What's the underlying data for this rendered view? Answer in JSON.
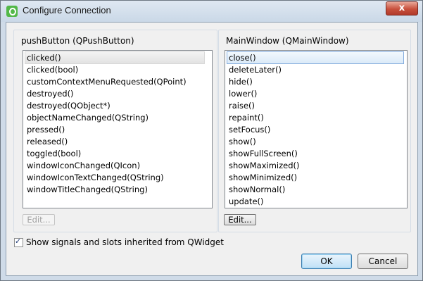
{
  "window": {
    "title": "Configure Connection",
    "close_label": "x"
  },
  "sender": {
    "group_title": "pushButton (QPushButton)",
    "signals": [
      "clicked()",
      "clicked(bool)",
      "customContextMenuRequested(QPoint)",
      "destroyed()",
      "destroyed(QObject*)",
      "objectNameChanged(QString)",
      "pressed()",
      "released()",
      "toggled(bool)",
      "windowIconChanged(QIcon)",
      "windowIconTextChanged(QString)",
      "windowTitleChanged(QString)"
    ],
    "selected_index": 0,
    "edit_label": "Edit..."
  },
  "receiver": {
    "group_title": "MainWindow (QMainWindow)",
    "slots": [
      "close()",
      "deleteLater()",
      "hide()",
      "lower()",
      "raise()",
      "repaint()",
      "setFocus()",
      "show()",
      "showFullScreen()",
      "showMaximized()",
      "showMinimized()",
      "showNormal()",
      "update()"
    ],
    "selected_index": 0,
    "edit_label": "Edit..."
  },
  "options": {
    "show_inherited_label": "Show signals and slots inherited from QWidget",
    "show_inherited_checked": true
  },
  "buttons": {
    "ok_label": "OK",
    "cancel_label": "Cancel"
  }
}
